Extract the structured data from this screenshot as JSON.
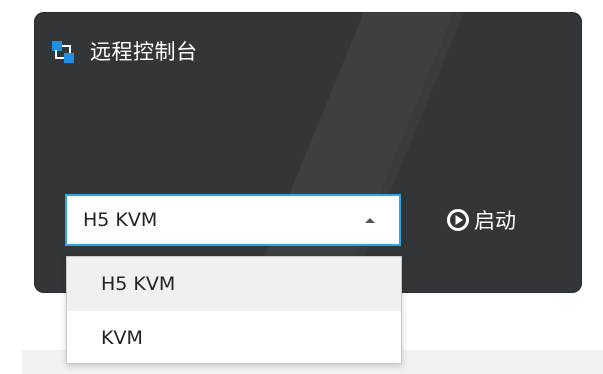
{
  "card": {
    "title": "远程控制台",
    "icon": "remote-console-icon"
  },
  "console_type_select": {
    "selected_value": "H5 KVM",
    "expanded": true,
    "options": [
      {
        "label": "H5 KVM",
        "selected": true
      },
      {
        "label": "KVM",
        "selected": false
      }
    ]
  },
  "launch_button": {
    "label": "启动",
    "icon": "play-circle-icon"
  },
  "colors": {
    "card_background": "#333639",
    "focus_border": "#2aa8e6",
    "icon_accent": "#1e90e6",
    "selected_option_background": "#f0f0f0"
  }
}
